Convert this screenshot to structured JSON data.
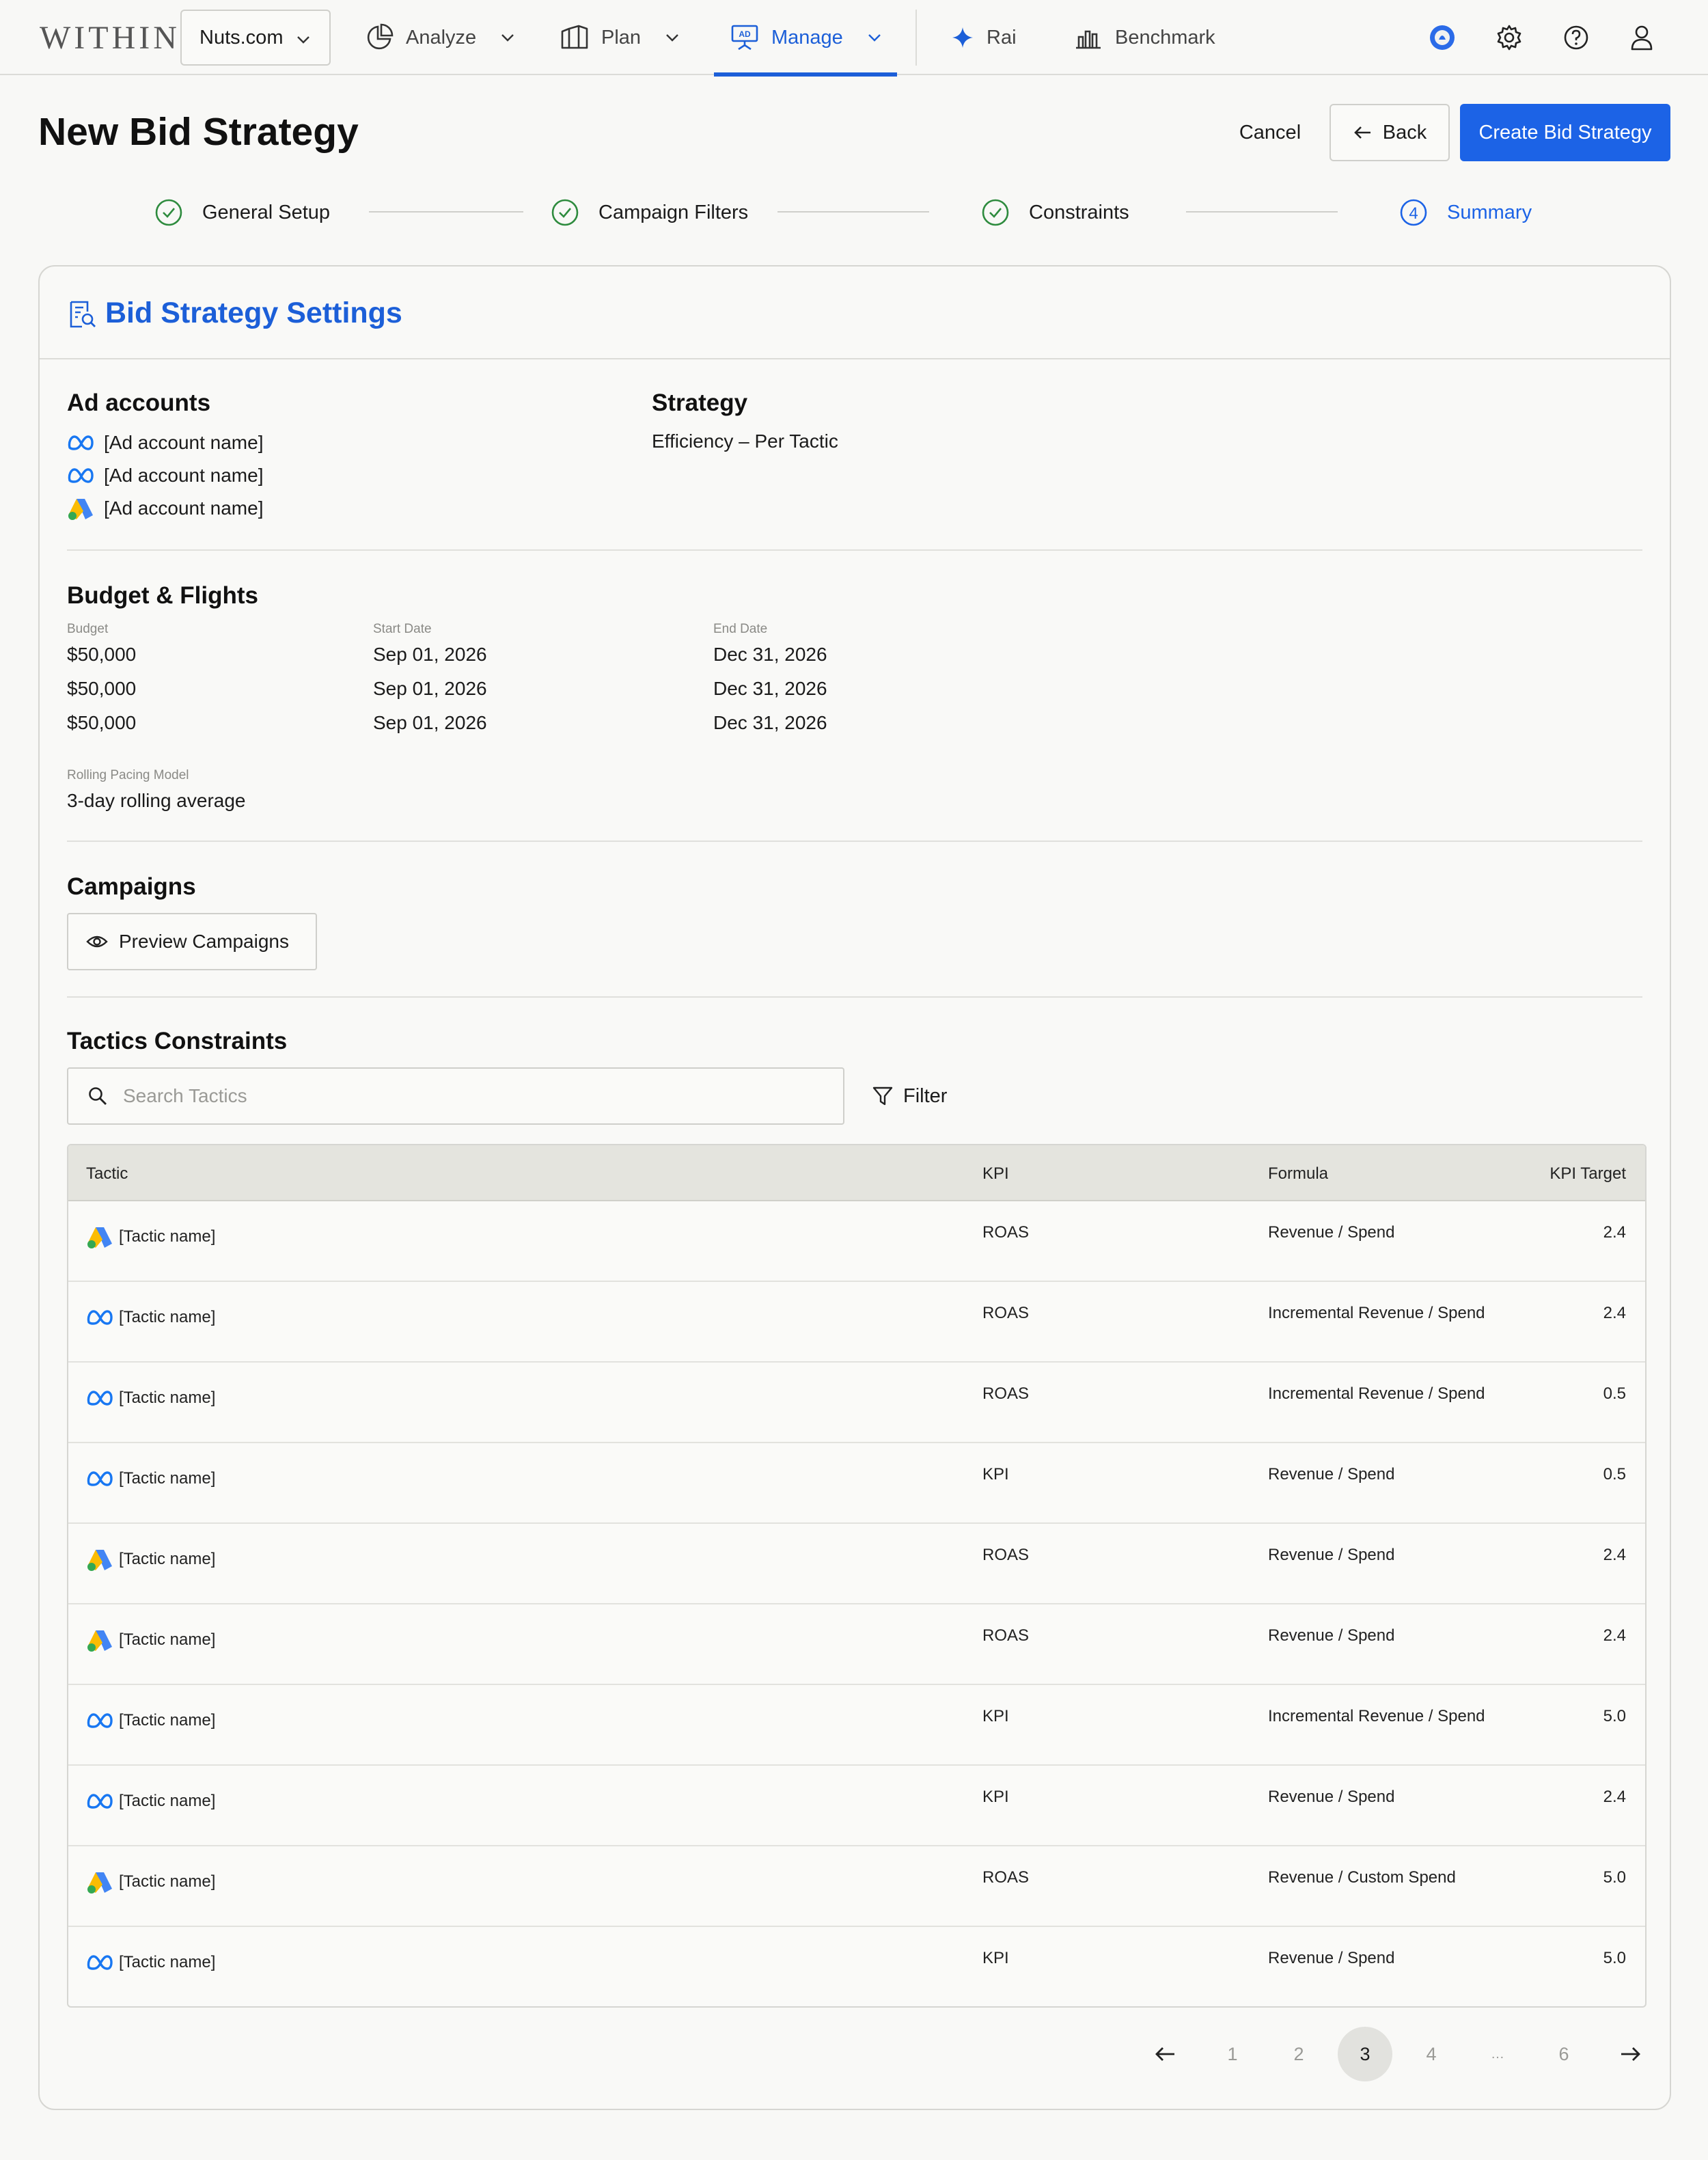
{
  "brand": {
    "logo": "WITHIN"
  },
  "nav": {
    "account": "Nuts.com",
    "items": [
      {
        "label": "Analyze"
      },
      {
        "label": "Plan"
      },
      {
        "label": "Manage"
      },
      {
        "label": "Rai"
      },
      {
        "label": "Benchmark"
      }
    ]
  },
  "header": {
    "title": "New Bid Strategy",
    "cancel_label": "Cancel",
    "back_label": "Back",
    "create_label": "Create Bid Strategy"
  },
  "steps": [
    {
      "label": "General Setup",
      "status": "done"
    },
    {
      "label": "Campaign Filters",
      "status": "done"
    },
    {
      "label": "Constraints",
      "status": "done"
    },
    {
      "label": "Summary",
      "status": "current",
      "number": "4"
    }
  ],
  "card": {
    "title": "Bid Strategy Settings",
    "ad_accounts": {
      "title": "Ad accounts",
      "items": [
        {
          "platform": "meta",
          "name": "[Ad account name]"
        },
        {
          "platform": "meta",
          "name": "[Ad account name]"
        },
        {
          "platform": "google-ads",
          "name": "[Ad account name]"
        }
      ]
    },
    "strategy": {
      "title": "Strategy",
      "value": "Efficiency – Per Tactic"
    },
    "budget": {
      "title": "Budget & Flights",
      "budget_label": "Budget",
      "start_label": "Start Date",
      "end_label": "End Date",
      "rows": [
        {
          "budget": "$50,000",
          "start": "Sep 01, 2026",
          "end": "Dec 31, 2026"
        },
        {
          "budget": "$50,000",
          "start": "Sep 01, 2026",
          "end": "Dec 31, 2026"
        },
        {
          "budget": "$50,000",
          "start": "Sep 01, 2026",
          "end": "Dec 31, 2026"
        }
      ],
      "pacing_label": "Rolling Pacing Model",
      "pacing_value": "3-day rolling average"
    },
    "campaigns": {
      "title": "Campaigns",
      "preview_label": "Preview Campaigns"
    },
    "tactics": {
      "title": "Tactics Constraints",
      "search_placeholder": "Search Tactics",
      "filter_label": "Filter",
      "columns": {
        "tactic": "Tactic",
        "kpi": "KPI",
        "formula": "Formula",
        "target": "KPI Target"
      },
      "rows": [
        {
          "platform": "google-ads",
          "tactic": "[Tactic name]",
          "kpi": "ROAS",
          "formula": "Revenue / Spend",
          "target": "2.4"
        },
        {
          "platform": "meta",
          "tactic": "[Tactic name]",
          "kpi": "ROAS",
          "formula": "Incremental Revenue / Spend",
          "target": "2.4"
        },
        {
          "platform": "meta",
          "tactic": "[Tactic name]",
          "kpi": "ROAS",
          "formula": "Incremental Revenue / Spend",
          "target": "0.5"
        },
        {
          "platform": "meta",
          "tactic": "[Tactic name]",
          "kpi": "KPI",
          "formula": "Revenue / Spend",
          "target": "0.5"
        },
        {
          "platform": "google-ads",
          "tactic": "[Tactic name]",
          "kpi": "ROAS",
          "formula": "Revenue / Spend",
          "target": "2.4"
        },
        {
          "platform": "google-ads",
          "tactic": "[Tactic name]",
          "kpi": "ROAS",
          "formula": "Revenue / Spend",
          "target": "2.4"
        },
        {
          "platform": "meta",
          "tactic": "[Tactic name]",
          "kpi": "KPI",
          "formula": "Incremental Revenue / Spend",
          "target": "5.0"
        },
        {
          "platform": "meta",
          "tactic": "[Tactic name]",
          "kpi": "KPI",
          "formula": "Revenue / Spend",
          "target": "2.4"
        },
        {
          "platform": "google-ads",
          "tactic": "[Tactic name]",
          "kpi": "ROAS",
          "formula": "Revenue / Custom Spend",
          "target": "5.0"
        },
        {
          "platform": "meta",
          "tactic": "[Tactic name]",
          "kpi": "KPI",
          "formula": "Revenue / Spend",
          "target": "5.0"
        }
      ]
    },
    "pagination": {
      "pages": [
        "1",
        "2",
        "3",
        "4",
        "…",
        "6"
      ],
      "current": "3"
    }
  },
  "colors": {
    "accent": "#1c63e6",
    "success": "#2e8b3e",
    "meta_blue": "#1877f2"
  }
}
